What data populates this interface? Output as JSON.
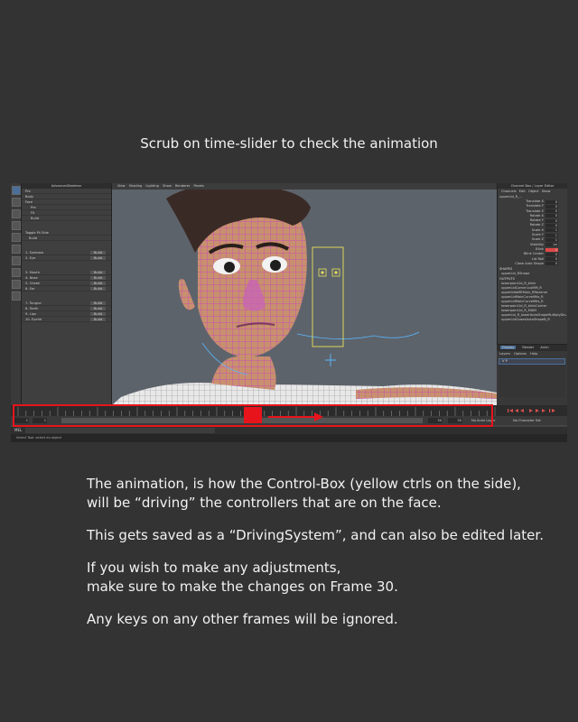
{
  "caption": "Scrub on time-slider to check the animation",
  "body": {
    "p1_line1": "The animation, is how the Control-Box (yellow ctrls on the side),",
    "p1_line2": "will be “driving” the controllers that are on the face.",
    "p2": "This gets saved as a “DrivingSystem”, and can also be edited later.",
    "p3_line1": "If you wish to make any adjustments,",
    "p3_line2": "make sure to make the changes on Frame 30.",
    "p4": "Any keys on any other frames will be ignored."
  },
  "maya": {
    "viewport_menu": "View  Shading  Lighting  Show  Renderer  Panels",
    "attribute_panel": {
      "title": "AdvancedSkeleton",
      "items": [
        "Pre",
        "Body",
        "Face",
        "Pre",
        "Fit",
        "Build"
      ],
      "toggle_label": "Toggle Fit Side",
      "build_label": "Build",
      "rows": [
        {
          "label": "1- Eyebrow",
          "button": "Build"
        },
        {
          "label": "2- Eye",
          "button": "Build"
        },
        {
          "label": "3- Mouth",
          "button": "Build"
        },
        {
          "label": "4- Nose",
          "button": "Build"
        },
        {
          "label": "5- Cheek",
          "button": "Build"
        },
        {
          "label": "6- Ear",
          "button": "Build"
        },
        {
          "label": "7- Tongue",
          "button": "Build"
        },
        {
          "label": "8- Teeth",
          "button": "Build"
        },
        {
          "label": "9- Lips",
          "button": "Build"
        },
        {
          "label": "10- Eyelid",
          "button": "Build"
        }
      ]
    },
    "channel_box": {
      "title": "Channel Box / Layer Editor",
      "menu": "Channels  Edit  Object  Show",
      "object": "upperLid_R_...",
      "channels": [
        {
          "name": "Translate X",
          "value": "0"
        },
        {
          "name": "Translate Y",
          "value": "0"
        },
        {
          "name": "Translate Z",
          "value": "0"
        },
        {
          "name": "Rotate X",
          "value": "0"
        },
        {
          "name": "Rotate Y",
          "value": "0"
        },
        {
          "name": "Rotate Z",
          "value": "0"
        },
        {
          "name": "Scale X",
          "value": "1"
        },
        {
          "name": "Scale Y",
          "value": "1"
        },
        {
          "name": "Scale Z",
          "value": "1"
        },
        {
          "name": "Visibility",
          "value": "on"
        },
        {
          "name": "Blink",
          "value": "0",
          "highlight": true
        },
        {
          "name": "Blink Center",
          "value": "0"
        },
        {
          "name": "Lid Roll",
          "value": "0"
        },
        {
          "name": "Close Auto Shape",
          "value": "0"
        }
      ],
      "shapes_label": "SHAPES",
      "shapes": [
        "upperLid_RShape"
      ],
      "outputs_label": "OUTPUTS",
      "outputs": [
        "lowerpoint1d_R_blink",
        "upperLidCorner1caMM_R",
        "upperlidlaMRMain_RReverse",
        "upperLidMainCurveMits_R",
        "upperLidMainCurveMits_R",
        "lowerpoint1d_R_blinkCenter",
        "lowerpoint1d_R_MAIN",
        "upperLid_R_lowerAutoShapeMultiplyDiv...",
        "upperLidClosesAutoShapeB_R"
      ]
    },
    "layer_editor": {
      "tabs": [
        "Display",
        "Render",
        "Anim"
      ],
      "active_tab": "Display",
      "menu": "Layers  Options  Help",
      "layer_name": "V  P"
    },
    "time_slider": {
      "start": "1",
      "range_start": "1",
      "range_end": "30",
      "end": "30",
      "fps": "No Anim Layer",
      "char_set": "No Character Set",
      "current_frame_fraction": 0.5
    },
    "cmd_label": "MEL",
    "help_line": "Select Tool: select an object",
    "colors": {
      "annotation": "#e8141c",
      "control_box": "#e8e05a",
      "wire": "#c83cc8",
      "skin": "#c8906e"
    }
  }
}
